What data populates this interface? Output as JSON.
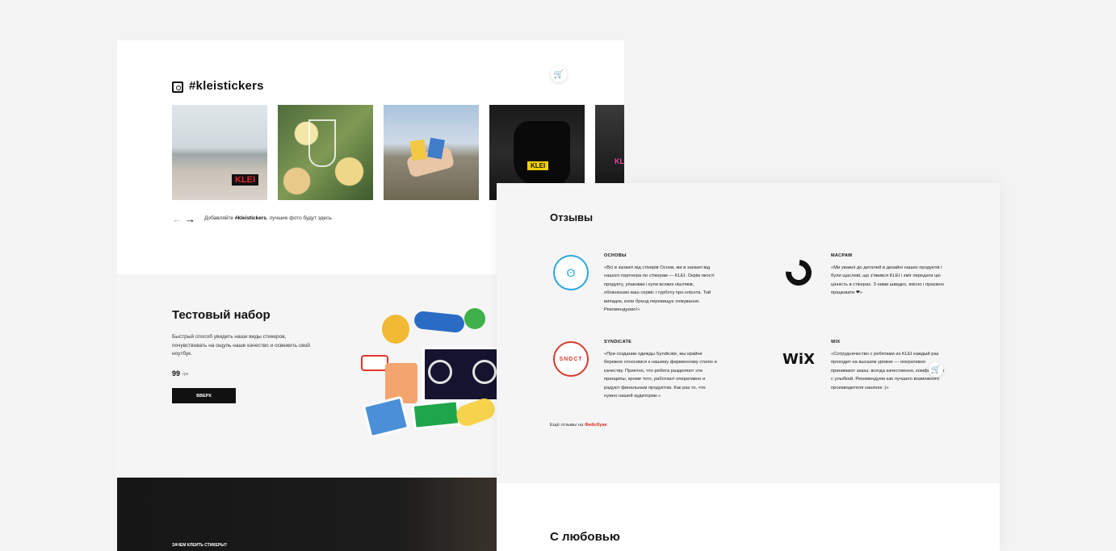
{
  "instagram": {
    "title": "#kleistickers",
    "caption_prefix": "Добавляйте ",
    "caption_tag": "#kleistickers",
    "caption_suffix": ", лучшие фото будут здесь.",
    "photos": [
      "photo-1",
      "photo-2",
      "photo-3",
      "photo-4",
      "photo-5"
    ],
    "photo_tag": "KLEI"
  },
  "icons": {
    "instagram": "instagram-icon",
    "cart": "cart-icon",
    "arrow_left": "←",
    "arrow_right": "→",
    "cart_glyph": "🛒"
  },
  "test_set": {
    "title": "Тестовый набор",
    "description": "Быстрый способ увидеть наши виды стикеров, почувствовать на ощупь наше качество и освежить свой ноутбук.",
    "price": "99",
    "currency": "грн",
    "button_label": "ВВЕРХ"
  },
  "dark_section": {
    "label": "ЗАЧЕМ КЛЕИТЬ СТИКЕРЫ?"
  },
  "reviews": {
    "title": "Отзывы",
    "items": [
      {
        "name": "ОСНОВЫ",
        "text": "«Всі в захваті від стікерів Основ, ми в захваті від нашого партнера по стікерам — KLEI. Окрім якості продукту, упаковки і купи всяких ніштяків, обожнюємо ваш сервіс і турботу про клієнта. Той випадок, коли бренд перевищує очікування. Рекомендуємо!»"
      },
      {
        "name": "MACPAW",
        "text": "«Ми уважні до деталей в дизайні наших продуктів і були щасливі, що з'явився KLEI і зміг передати цю цінність в стікерах. З ними швидко, якісно і приємно працювати ❤»"
      },
      {
        "name": "SYNDICATE",
        "text": "«При создании одежды Syndicate, мы крайне бережно относимся к нашему фирменному стилю и качеству. Приятно, что ребята разделяют эти принципы, кроме того, работают оперативно и радуют финальным продуктом. Как раз то, что нужно нашей аудитории.»"
      },
      {
        "name": "WIX",
        "text": "«Сотрудничество с ребятами из KLEI каждый раз проходит на высшем уровне — оперативно принимают заказ, всегда качественно, комфортно и с улыбкой. Рекомендуем как лучшего возможного производителя наклеек :)»"
      }
    ],
    "logos": {
      "syndicate": "SNDCT",
      "wix": "WiX",
      "osnovy": "ʘ"
    },
    "more_prefix": "Ещё отзывы на ",
    "more_link": "Фейсбуке"
  },
  "love": {
    "title": "С любовью"
  },
  "colors": {
    "accent_red": "#d32a1f",
    "osnovy_blue": "#2aa7dd",
    "syndicate_red": "#d63a2d"
  }
}
